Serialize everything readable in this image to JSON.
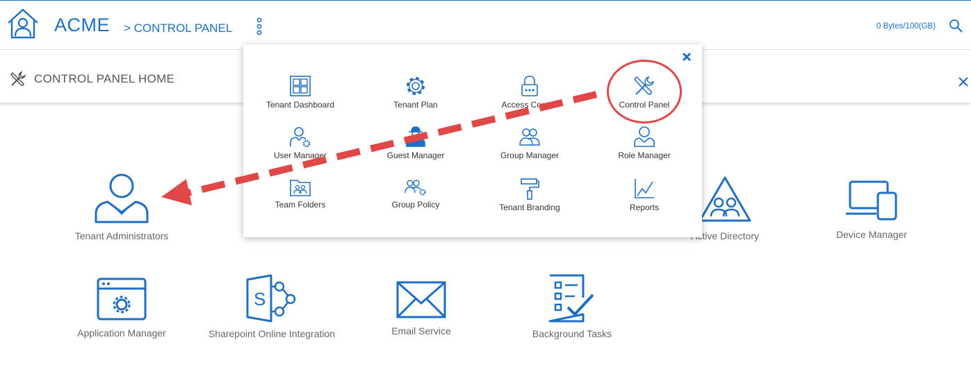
{
  "header": {
    "brand": "ACME",
    "breadcrumb": "> CONTROL PANEL",
    "storage": "0 Bytes/100(GB)"
  },
  "subheader": {
    "title": "CONTROL PANEL HOME"
  },
  "tiles": [
    {
      "label": "Tenant Administrators",
      "icon": "admin-user-icon"
    },
    {
      "label": "Active Directory",
      "icon": "active-directory-icon"
    },
    {
      "label": "Device Manager",
      "icon": "device-manager-icon"
    },
    {
      "label": "Application Manager",
      "icon": "application-manager-icon"
    },
    {
      "label": "Sharepoint Online Integration",
      "icon": "sharepoint-icon"
    },
    {
      "label": "Email Service",
      "icon": "envelope-icon"
    },
    {
      "label": "Background Tasks",
      "icon": "checklist-icon"
    }
  ],
  "menu": {
    "items": [
      {
        "label": "Tenant Dashboard",
        "icon": "dashboard-grid-icon"
      },
      {
        "label": "Tenant Plan",
        "icon": "gear-icon"
      },
      {
        "label": "Access Control",
        "icon": "lock-icon"
      },
      {
        "label": "Control Panel",
        "icon": "tools-icon"
      },
      {
        "label": "User Manager",
        "icon": "user-gear-icon"
      },
      {
        "label": "Guest Manager",
        "icon": "guest-user-icon"
      },
      {
        "label": "Group Manager",
        "icon": "group-icon"
      },
      {
        "label": "Role Manager",
        "icon": "role-user-icon"
      },
      {
        "label": "Team Folders",
        "icon": "team-folder-icon"
      },
      {
        "label": "Group Policy",
        "icon": "group-policy-icon"
      },
      {
        "label": "Tenant Branding",
        "icon": "paint-roller-icon"
      },
      {
        "label": "Reports",
        "icon": "chart-icon"
      }
    ]
  },
  "colors": {
    "accent": "#1e6fc4",
    "annotation": "#e04848",
    "label_gray": "#666666"
  }
}
